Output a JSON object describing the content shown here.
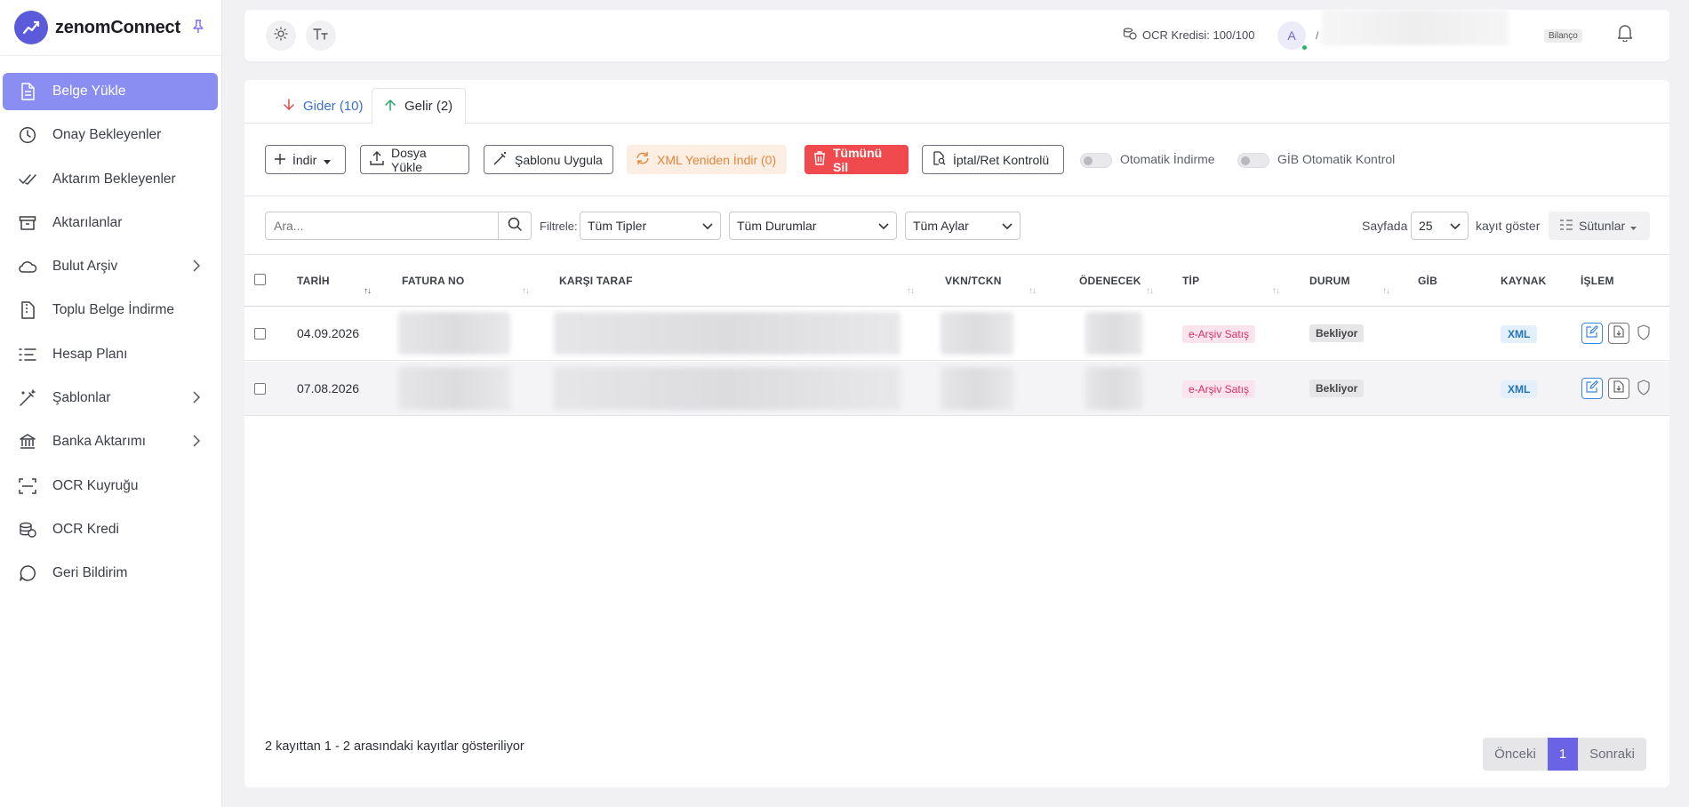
{
  "brand": {
    "name": "zenomConnect"
  },
  "sidebar": {
    "items": [
      {
        "label": "Belge Yükle",
        "icon": "file-icon"
      },
      {
        "label": "Onay Bekleyenler",
        "icon": "clock-icon"
      },
      {
        "label": "Aktarım Bekleyenler",
        "icon": "double-check-icon"
      },
      {
        "label": "Aktarılanlar",
        "icon": "archive-icon"
      },
      {
        "label": "Bulut Arşiv",
        "icon": "cloud-icon"
      },
      {
        "label": "Toplu Belge İndirme",
        "icon": "file-zip-icon"
      },
      {
        "label": "Hesap Planı",
        "icon": "list-icon"
      },
      {
        "label": "Şablonlar",
        "icon": "magic-wand-icon"
      },
      {
        "label": "Banka Aktarımı",
        "icon": "bank-icon"
      },
      {
        "label": "OCR Kuyruğu",
        "icon": "scan-icon"
      },
      {
        "label": "OCR Kredi",
        "icon": "coins-icon"
      },
      {
        "label": "Geri Bildirim",
        "icon": "chat-icon"
      }
    ]
  },
  "header": {
    "ocr_credit": "OCR Kredisi: 100/100",
    "avatar_initial": "A",
    "user_initial_suffix": "/",
    "role_badge": "Bilanço"
  },
  "tabs": [
    {
      "label": "Gider (10)"
    },
    {
      "label": "Gelir (2)"
    }
  ],
  "toolbar": {
    "indir": "İndir",
    "dosya_yukle": "Dosya Yükle",
    "sablonu_uygula": "Şablonu Uygula",
    "xml_yeniden_indir": "XML Yeniden İndir (0)",
    "tumunu_sil": "Tümünü Sil",
    "iptal_ret": "İptal/Ret Kontrolü",
    "otomatik_indirme": "Otomatik İndirme",
    "gib_otomatik": "GİB Otomatik Kontrol"
  },
  "filters": {
    "search_placeholder": "Ara...",
    "filter_label": "Filtrele:",
    "types": "Tüm Tipler",
    "statuses": "Tüm Durumlar",
    "months": "Tüm Aylar",
    "page_label": "Sayfada",
    "page_size": "25",
    "show_label": "kayıt göster",
    "columns_label": "Sütunlar"
  },
  "table": {
    "columns": [
      "TARİH",
      "FATURA NO",
      "KARŞI TARAF",
      "VKN/TCKN",
      "ÖDENECEK",
      "TİP",
      "DURUM",
      "GİB",
      "KAYNAK",
      "İŞLEM"
    ],
    "rows": [
      {
        "tarih": "04.09.2026",
        "tip": "e-Arşiv Satış",
        "durum": "Bekliyor",
        "kaynak": "XML"
      },
      {
        "tarih": "07.08.2026",
        "tip": "e-Arşiv Satış",
        "durum": "Bekliyor",
        "kaynak": "XML"
      }
    ]
  },
  "footer": {
    "info": "2 kayıttan 1 - 2 arasındaki kayıtlar gösteriliyor",
    "prev": "Önceki",
    "current_page": "1",
    "next": "Sonraki"
  },
  "colors": {
    "accent": "#6b63e6",
    "active_nav": "#8a8ef2",
    "danger": "#f04a4f",
    "warning_bg": "#fdeee3"
  }
}
